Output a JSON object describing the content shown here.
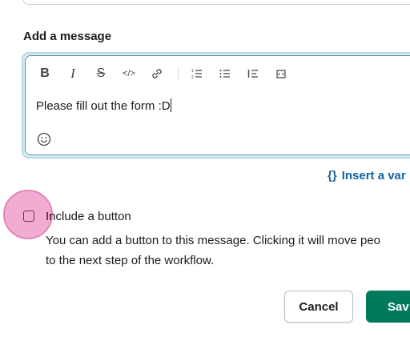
{
  "section_label": "Add a message",
  "toolbar": {
    "items": [
      {
        "name": "bold-icon",
        "glyph": "B"
      },
      {
        "name": "italic-icon",
        "glyph": "I"
      },
      {
        "name": "strikethrough-icon",
        "glyph": "S"
      },
      {
        "name": "code-icon",
        "glyph": "</>"
      },
      {
        "name": "link-icon",
        "glyph": "link"
      },
      {
        "name": "ordered-list-icon",
        "glyph": "ol"
      },
      {
        "name": "bulleted-list-icon",
        "glyph": "ul"
      },
      {
        "name": "blockquote-icon",
        "glyph": "quote"
      },
      {
        "name": "code-block-icon",
        "glyph": "codeblock"
      }
    ]
  },
  "message": {
    "text": "Please fill out the form :D"
  },
  "emoji_icon": "smiley-icon",
  "insert_variable": {
    "braces": "{}",
    "label": "Insert a var"
  },
  "include_button": {
    "checked": false,
    "title": "Include a button",
    "description_line1": "You can add a button to this message. Clicking it will move peo",
    "description_line2": "to the next step of the workflow."
  },
  "actions": {
    "cancel": "Cancel",
    "save": "Sav"
  },
  "colors": {
    "save_bg": "#007a5a",
    "link": "#1264a3",
    "focus_ring": "#b7d8e6",
    "cursor_highlight": "#f0a6cf"
  }
}
